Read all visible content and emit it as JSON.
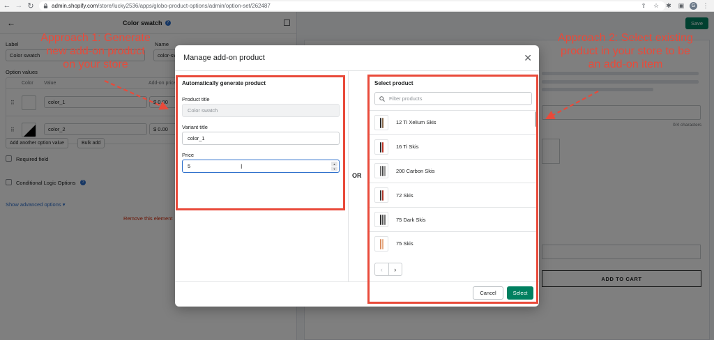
{
  "browser": {
    "url_host": "admin.shopify.com",
    "url_path": "/store/lucky2536/apps/globo-product-options/admin/option-set/262487",
    "profile_initial": "G"
  },
  "editor": {
    "header_title": "Color swatch",
    "label_label": "Label",
    "label_value": "Color swatch",
    "name_label": "Name",
    "name_value": "color-sw",
    "option_values_label": "Option values",
    "col_color": "Color",
    "col_value": "Value",
    "col_addon": "Add-on price",
    "rows": [
      {
        "value": "color_1",
        "currency": "$",
        "price": "0.00"
      },
      {
        "value": "color_2",
        "currency": "$",
        "price": "0.00"
      }
    ],
    "add_another_label": "Add another option value",
    "bulk_add_label": "Bulk add",
    "required_label": "Required field",
    "conditional_label": "Conditional Logic Options",
    "advanced_label": "Show advanced options ▾",
    "remove_label": "Remove this element"
  },
  "preview": {
    "save_label": "Save",
    "char_count": "0/4 characters",
    "add_to_cart_label": "ADD TO CART"
  },
  "modal": {
    "title": "Manage add-on product",
    "close_glyph": "✕",
    "left": {
      "section_title": "Automatically generate product",
      "product_title_label": "Product title",
      "product_title_value": "Color swatch",
      "variant_title_label": "Variant title",
      "variant_title_value": "color_1",
      "price_label": "Price",
      "price_value": "5"
    },
    "or_label": "OR",
    "right": {
      "section_title": "Select product",
      "filter_placeholder": "Filter products",
      "products": [
        {
          "name": "12 Ti Xelium Skis",
          "colors": [
            "#2b2b2b",
            "#8a6b4e"
          ]
        },
        {
          "name": "16 Ti Skis",
          "colors": [
            "#2b2b2b",
            "#c0392b"
          ]
        },
        {
          "name": "200 Carbon Skis",
          "colors": [
            "#6d6d6d",
            "#4a4a4a",
            "#9a9a9a"
          ]
        },
        {
          "name": "72 Skis",
          "colors": [
            "#3a3a3a",
            "#b03a2e"
          ]
        },
        {
          "name": "75 Dark Skis",
          "colors": [
            "#2e2e2e",
            "#555555",
            "#777777"
          ]
        },
        {
          "name": "75 Skis",
          "colors": [
            "#d98c5f",
            "#e8b08a"
          ]
        }
      ],
      "prev_glyph": "‹",
      "next_glyph": "›"
    },
    "cancel_label": "Cancel",
    "select_label": "Select"
  },
  "annotations": {
    "approach1": [
      "Approach 1: Generate",
      "new add-on product",
      "on your store"
    ],
    "approach2": [
      "Approach 2: Select existing",
      "product in your store to be",
      "an add-on item"
    ],
    "color": "#e94a3a"
  }
}
